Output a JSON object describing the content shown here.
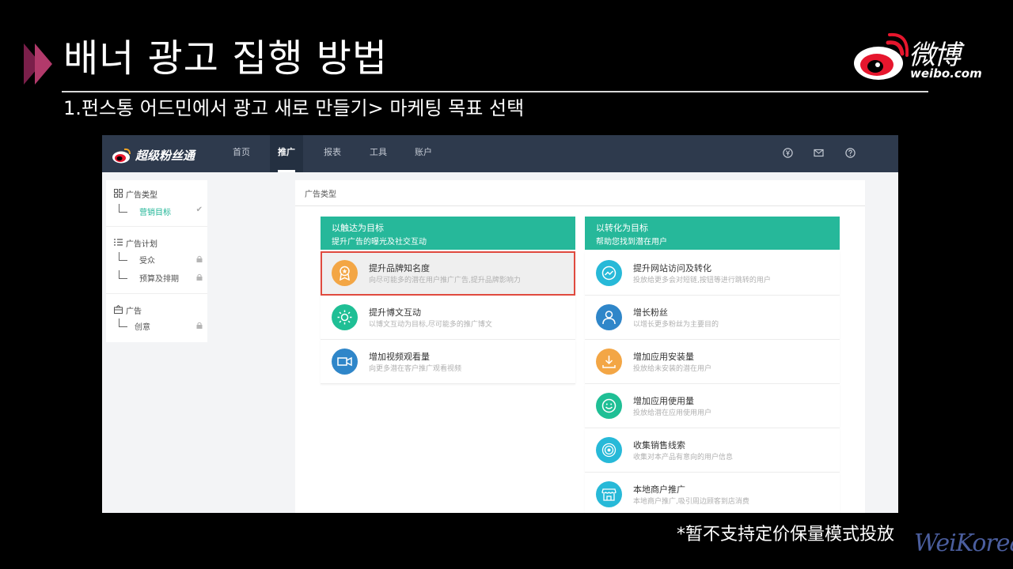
{
  "slide": {
    "title": "배너 광고 집행 방법",
    "subtitle": "1.펀스통 어드민에서 광고 새로 만들기> 마케팅 목표 선택",
    "brand_text": "微博",
    "brand_url": "weibo.com",
    "footnote": "*暂不支持定价保量模式投放",
    "watermark": "WeiKorea"
  },
  "app": {
    "logo_text": "超级粉丝通",
    "nav": [
      "首页",
      "推广",
      "报表",
      "工具",
      "账户"
    ],
    "active_nav": "推广",
    "header_icons": [
      "yen-icon",
      "mail-icon",
      "help-icon"
    ]
  },
  "sidebar": {
    "groups": [
      {
        "heading": "广告类型",
        "icon": "grid-icon",
        "items": [
          {
            "label": "营销目标",
            "mark": "✔"
          }
        ]
      },
      {
        "heading": "广告计划",
        "icon": "list-icon",
        "items": [
          {
            "label": "受众",
            "mark": "lock"
          },
          {
            "label": "预算及排期",
            "mark": "lock"
          }
        ]
      },
      {
        "heading": "广告",
        "icon": "ad-icon",
        "items": [
          {
            "label": "创意",
            "mark": "lock"
          }
        ]
      }
    ]
  },
  "panel": {
    "title": "广告类型",
    "columns": [
      {
        "title": "以触达为目标",
        "subtitle": "提升广告的曝光及社交互动",
        "options": [
          {
            "title": "提升品牌知名度",
            "desc": "向尽可能多的潜在用户推广广告,提升品牌影响力",
            "icon": "badge-icon",
            "color": "#f3a645",
            "selected": true
          },
          {
            "title": "提升博文互动",
            "desc": "以博文互动为目标,尽可能多的推广博文",
            "icon": "sun-icon",
            "color": "#1fbf95",
            "selected": false
          },
          {
            "title": "增加视频观看量",
            "desc": "向更多潜在客户推广观看视频",
            "icon": "video-icon",
            "color": "#2f86c9",
            "selected": false
          }
        ]
      },
      {
        "title": "以转化为目标",
        "subtitle": "帮助您找到潜在用户",
        "options": [
          {
            "title": "提升网站访问及转化",
            "desc": "投放给更多会对短链,按钮等进行跳转的用户",
            "icon": "trend-icon",
            "color": "#27b9d8",
            "selected": false
          },
          {
            "title": "增长粉丝",
            "desc": "以增长更多粉丝为主要目的",
            "icon": "user-icon",
            "color": "#2f86c9",
            "selected": false
          },
          {
            "title": "增加应用安装量",
            "desc": "投放给未安装的潜在用户",
            "icon": "download-icon",
            "color": "#f3a645",
            "selected": false
          },
          {
            "title": "增加应用使用量",
            "desc": "投放给潜在应用使用用户",
            "icon": "smile-icon",
            "color": "#1fbf95",
            "selected": false
          },
          {
            "title": "收集销售线索",
            "desc": "收集对本产品有意向的用户信息",
            "icon": "target-icon",
            "color": "#27b9d8",
            "selected": false
          },
          {
            "title": "本地商户推广",
            "desc": "本地商户推广,吸引周边顾客到店消费",
            "icon": "store-icon",
            "color": "#27b9d8",
            "selected": false
          }
        ]
      }
    ]
  }
}
